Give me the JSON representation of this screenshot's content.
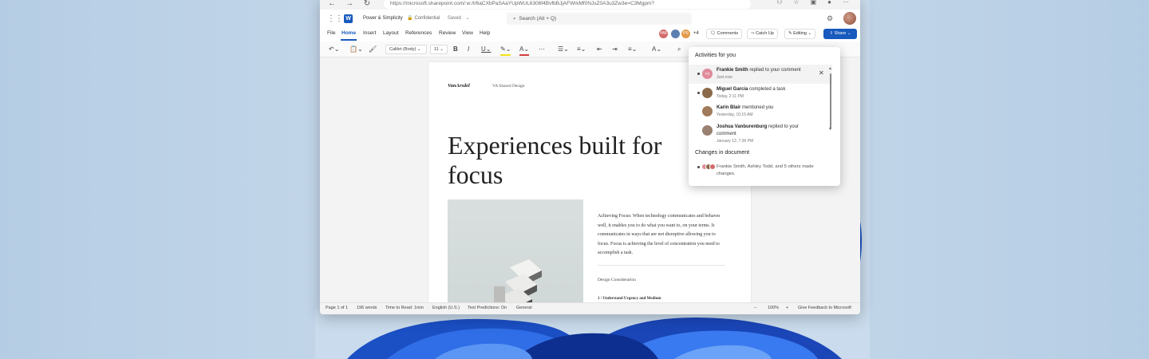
{
  "browser": {
    "url": "https://microsoft.sharepoint.com/:w:/t/6aCXbPaSAaYUpWUL6306f4BvfbBJjAFWrkMf0NJsZ0A3u3Zw3e=C3Mgpm?"
  },
  "app": {
    "doc_title": "Power & Simplicity",
    "sensitivity": "Confidential",
    "save_status": "Saved",
    "search_placeholder": "Search (Alt + Q)"
  },
  "menu": {
    "items": [
      "File",
      "Home",
      "Insert",
      "Layout",
      "References",
      "Review",
      "View",
      "Help"
    ],
    "active": "Home",
    "collaborators": [
      {
        "initials": "HW",
        "color": "#d46a6a"
      },
      {
        "initials": "",
        "color": "#5a7fb0"
      },
      {
        "initials": "",
        "color": "#3a8ed8"
      },
      {
        "initials": "PS",
        "color": "#e39a4b"
      }
    ],
    "more_collaborators": "+4",
    "comments": "Comments",
    "catch_up": "Catch Up",
    "editing": "Editing",
    "share": "Share"
  },
  "ribbon": {
    "font_name": "Calibri (Body)",
    "font_size": "11",
    "colors": {
      "highlight": "#f2e21a",
      "font_color": "#d23c3c"
    }
  },
  "document": {
    "brand": "VanArsdel",
    "brand_sub": "VA Shared Design",
    "headline": "Experiences built for focus",
    "body": "Achieving Focus: When technology communicates and behaves well, it enables you to do what you want to, on your terms. It communicates in ways that are not disruptive allowing you to focus. Focus is achieving the level of concentration you need to accomplish a task.",
    "section_heading": "Design Consideration",
    "section_item": "1 / Understand Urgency and Medium"
  },
  "status": {
    "page": "Page 1 of 1",
    "words": "196 words",
    "read_time": "Time to Read: 1min",
    "language": "English (U.S.)",
    "predictions": "Text Predictions: On",
    "general": "General",
    "zoom": "100%",
    "feedback": "Give Feedback to Microsoft"
  },
  "activities": {
    "heading": "Activities for you",
    "items": [
      {
        "name": "Frankie Smith",
        "action": "replied to your comment",
        "time": "Just now",
        "initials": "FS",
        "color": "#e08a9a"
      },
      {
        "name": "Miguel Garcia",
        "action": "completed a task",
        "time": "Today, 2:11 PM",
        "initials": "",
        "color": "#8a6a4a"
      },
      {
        "name": "Karin Blair",
        "action": "mentioned you",
        "time": "Yesterday, 10:15 AM",
        "initials": "",
        "color": "#a07a5a"
      },
      {
        "name": "Joshua Vanburenburg",
        "action": "replied to your comment",
        "time": "January 12, 7:36 PM",
        "initials": "",
        "color": "#9a8070"
      }
    ],
    "changes_heading": "Changes in document",
    "changes_text": "Frankie Smith, Ashley Todd, and 5 others made changes."
  }
}
